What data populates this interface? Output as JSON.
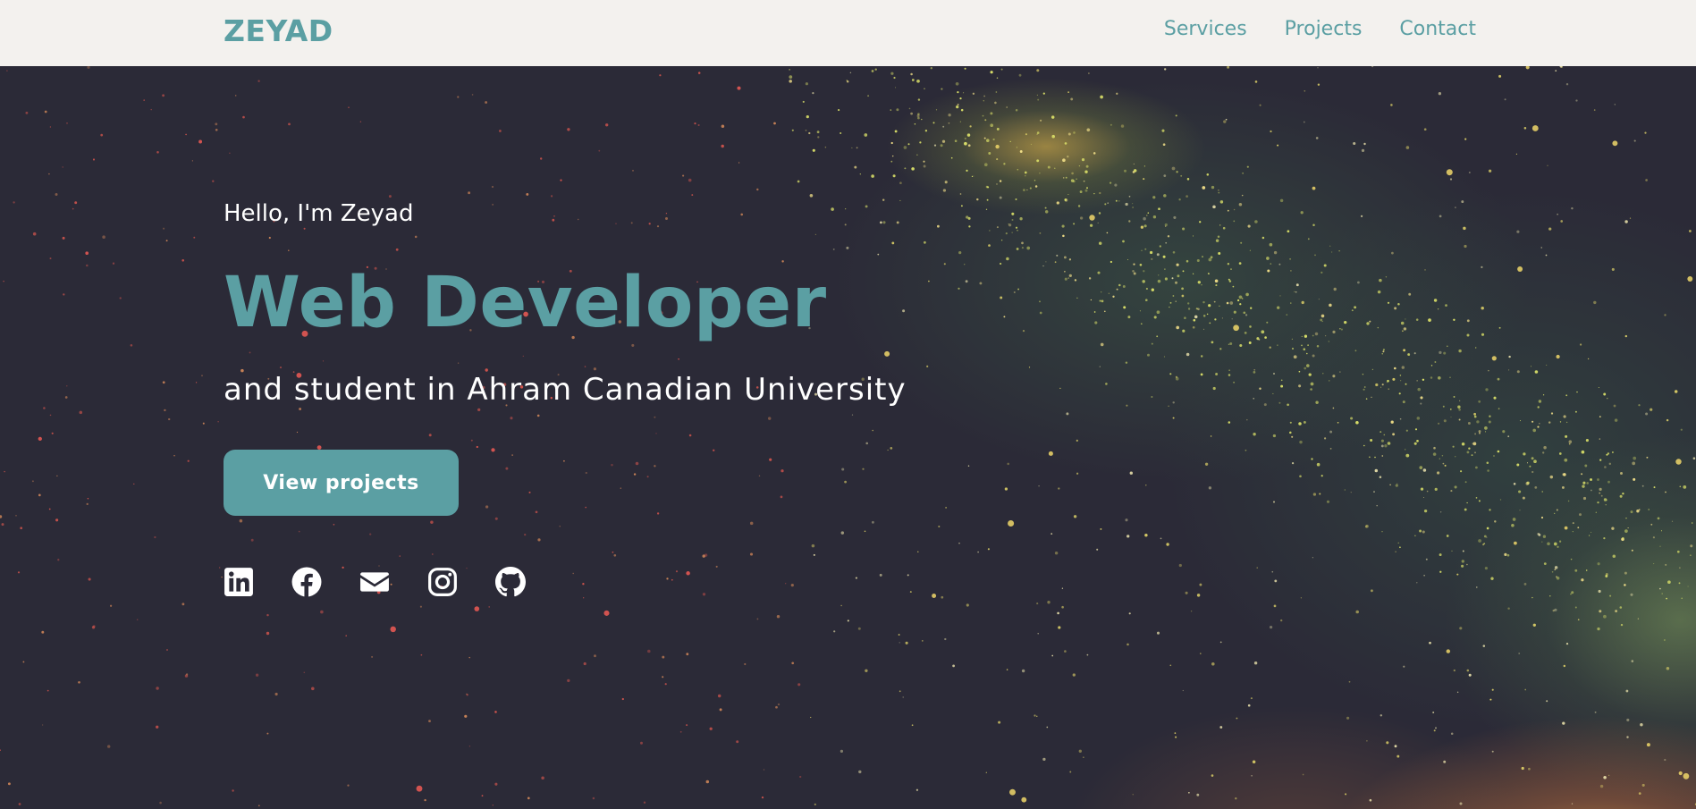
{
  "navbar": {
    "logo": "ZEYAD",
    "links": [
      {
        "label": "Services"
      },
      {
        "label": "Projects"
      },
      {
        "label": "Contact"
      }
    ]
  },
  "hero": {
    "greeting": "Hello, I'm Zeyad",
    "headline": "Web Developer",
    "subtitle": "and student in Ahram Canadian University",
    "cta_label": "View projects",
    "social_icons": [
      "linkedin-icon",
      "facebook-icon",
      "mail-icon",
      "instagram-icon",
      "github-icon"
    ]
  },
  "colors": {
    "accent": "#5b9fa3",
    "navbar_bg": "#f3f1ee",
    "hero_bg": "#2b2a37",
    "text_light": "#ffffff"
  }
}
